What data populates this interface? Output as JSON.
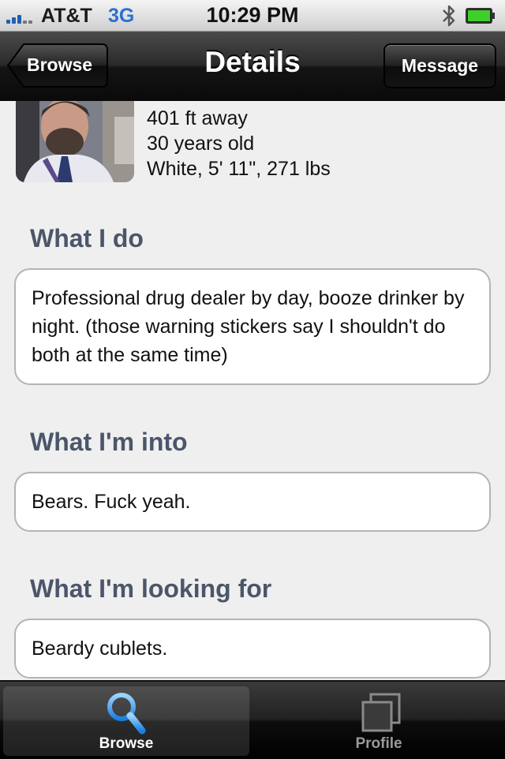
{
  "status_bar": {
    "carrier": "AT&T",
    "network": "3G",
    "time": "10:29 PM"
  },
  "nav": {
    "back_label": "Browse",
    "title": "Details",
    "message_label": "Message"
  },
  "profile": {
    "distance": "401 ft away",
    "age": "30 years old",
    "details": "White, 5' 11\", 271 lbs"
  },
  "sections": [
    {
      "title": "What I do",
      "body": "Professional drug dealer by day, booze drinker by night. (those warning stickers say I shouldn't do both at the same time)"
    },
    {
      "title": "What I'm into",
      "body": "Bears. Fuck yeah."
    },
    {
      "title": "What I'm looking for",
      "body": "Beardy cublets."
    }
  ],
  "tabs": [
    {
      "label": "Browse",
      "icon": "search-icon",
      "active": true
    },
    {
      "label": "Profile",
      "icon": "profile-photos-icon",
      "active": false
    }
  ],
  "colors": {
    "section_title": "#4c566a",
    "network": "#2b6fd1",
    "signal": "#1f5fb4",
    "battery": "#3ecf2a"
  }
}
